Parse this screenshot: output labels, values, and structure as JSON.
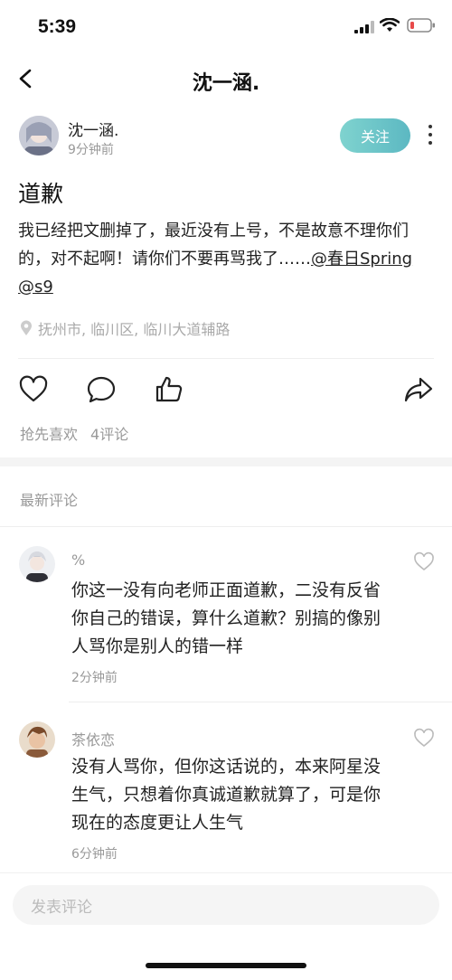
{
  "status_bar": {
    "time": "5:39"
  },
  "nav": {
    "title": "沈一涵."
  },
  "post": {
    "author": "沈一涵.",
    "time": "9分钟前",
    "follow_label": "关注",
    "title": "道歉",
    "body_text": "我已经把文删掉了，最近没有上号，不是故意不理你们的，对不起啊！请你们不要再骂我了……",
    "mention1": "@春日Spring",
    "mention2": "@s9",
    "location": "抚州市, 临川区, 临川大道辅路",
    "likes_label": "抢先喜欢",
    "comments_label": "4评论"
  },
  "comments_section": {
    "title": "最新评论"
  },
  "comments": [
    {
      "name": "%",
      "text": "你这一没有向老师正面道歉，二没有反省你自己的错误，算什么道歉？别搞的像别人骂你是别人的错一样",
      "time": "2分钟前"
    },
    {
      "name": "茶依恋",
      "text": "没有人骂你，但你这话说的，本来阿星没生气，只想着你真诚道歉就算了，可是你现在的态度更让人生气",
      "time": "6分钟前"
    }
  ],
  "input": {
    "placeholder": "发表评论"
  },
  "colors": {
    "follow_start": "#7fd3cf",
    "follow_end": "#5cb8c2",
    "battery_low": "#e84a4a"
  },
  "icons": [
    "back-icon",
    "more-icon",
    "location-icon",
    "heart-icon",
    "comment-icon",
    "thumbs-up-icon",
    "share-icon",
    "signal-icon",
    "wifi-icon",
    "battery-icon"
  ]
}
